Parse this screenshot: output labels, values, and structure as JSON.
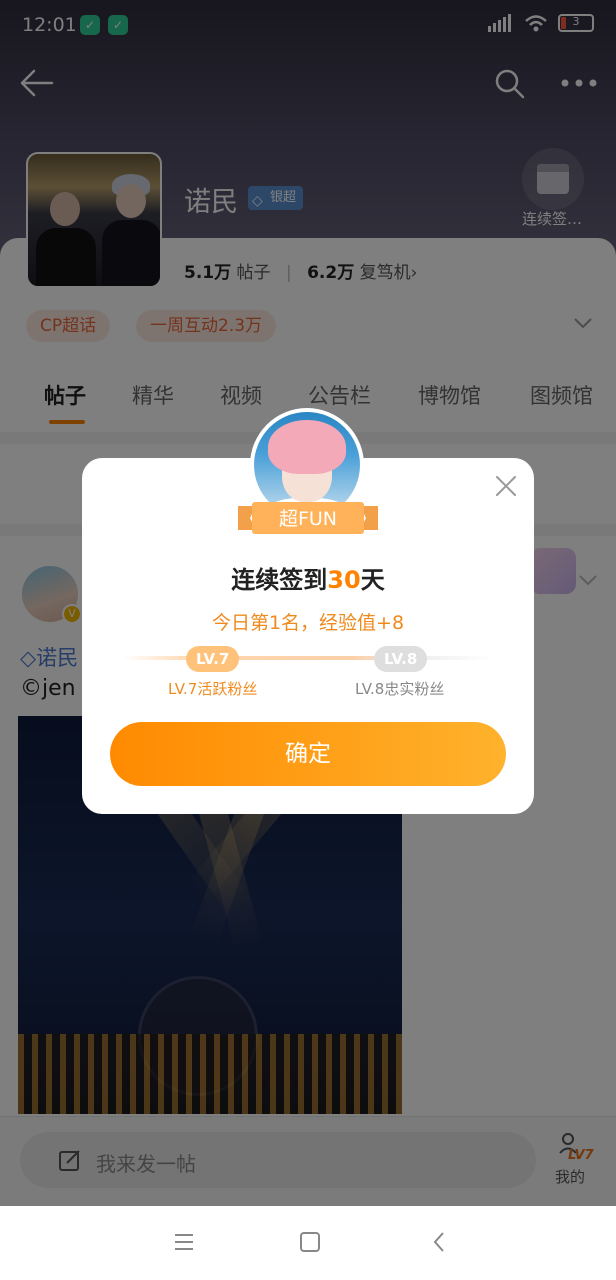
{
  "status": {
    "time": "12:01",
    "battery": "3"
  },
  "topic": {
    "name": "诺民",
    "badge": "银超",
    "checkin_label": "连续签…"
  },
  "stats": {
    "posts_value": "5.1万",
    "posts_label": "帖子",
    "repost_value": "6.2万",
    "repost_label": "复笃机"
  },
  "tags": [
    "CP超话",
    "一周互动2.3万"
  ],
  "tabs": [
    "帖子",
    "精华",
    "视频",
    "公告栏",
    "博物馆",
    "图频馆"
  ],
  "post": {
    "author_line": "诺民",
    "text_line": "©jen"
  },
  "compose": {
    "placeholder": "我来发一帖"
  },
  "mine": {
    "level": "LV7",
    "label": "我的"
  },
  "dialog": {
    "ribbon": "超FUN",
    "title_prefix": "连续签到",
    "title_days": "30",
    "title_suffix": "天",
    "subtitle": "今日第1名，经验值+8",
    "level_current": "LV.7",
    "level_next": "LV.8",
    "level_current_label": "LV.7活跃粉丝",
    "level_next_label": "LV.8忠实粉丝",
    "confirm": "确定"
  },
  "icons": [
    "back-arrow-icon",
    "search-icon",
    "more-icon",
    "calendar-icon",
    "chevron-down-icon",
    "close-icon",
    "edit-icon",
    "menu-icon",
    "home-square-icon",
    "back-triangle-icon",
    "shield-icon",
    "diamond-icon"
  ],
  "colors": {
    "accent": "#ff8200",
    "link": "#4a7bcf",
    "tag_bg": "#fde9df",
    "tag_fg": "#e8663a"
  }
}
